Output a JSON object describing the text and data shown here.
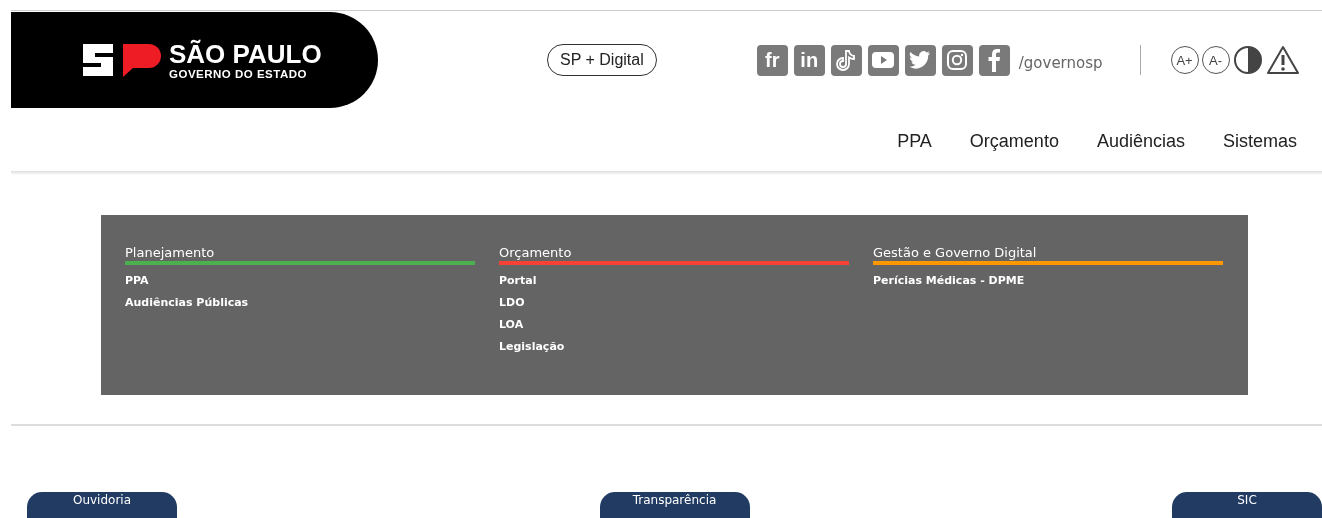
{
  "logo": {
    "title": "SÃO PAULO",
    "subtitle": "GOVERNO DO ESTADO"
  },
  "digital_button": "SP + Digital",
  "social": [
    {
      "kind": "text",
      "label": "fr"
    },
    {
      "kind": "text",
      "label": "in"
    },
    {
      "kind": "tiktok"
    },
    {
      "kind": "youtube"
    },
    {
      "kind": "twitter"
    },
    {
      "kind": "instagram"
    },
    {
      "kind": "facebook"
    }
  ],
  "social_handle": "/governosp",
  "accessibility": [
    {
      "kind": "circle",
      "label": "A+"
    },
    {
      "kind": "circle",
      "label": "A-"
    },
    {
      "kind": "contrast"
    },
    {
      "kind": "warning"
    }
  ],
  "nav": [
    "PPA",
    "Orçamento",
    "Audiências",
    "Sistemas"
  ],
  "menu_columns": [
    {
      "title": "Planejamento",
      "color": "#4caf50",
      "links": [
        "PPA",
        "Audiências Públicas"
      ]
    },
    {
      "title": "Orçamento",
      "color": "#f44336",
      "links": [
        "Portal",
        "LDO",
        "LOA",
        "Legislação"
      ]
    },
    {
      "title": "Gestão e Governo Digital",
      "color": "#ff9800",
      "links": [
        "Perícias Médicas - DPME"
      ]
    }
  ],
  "footer_buttons": [
    "Ouvidoria",
    "Transparência",
    "SIC"
  ]
}
